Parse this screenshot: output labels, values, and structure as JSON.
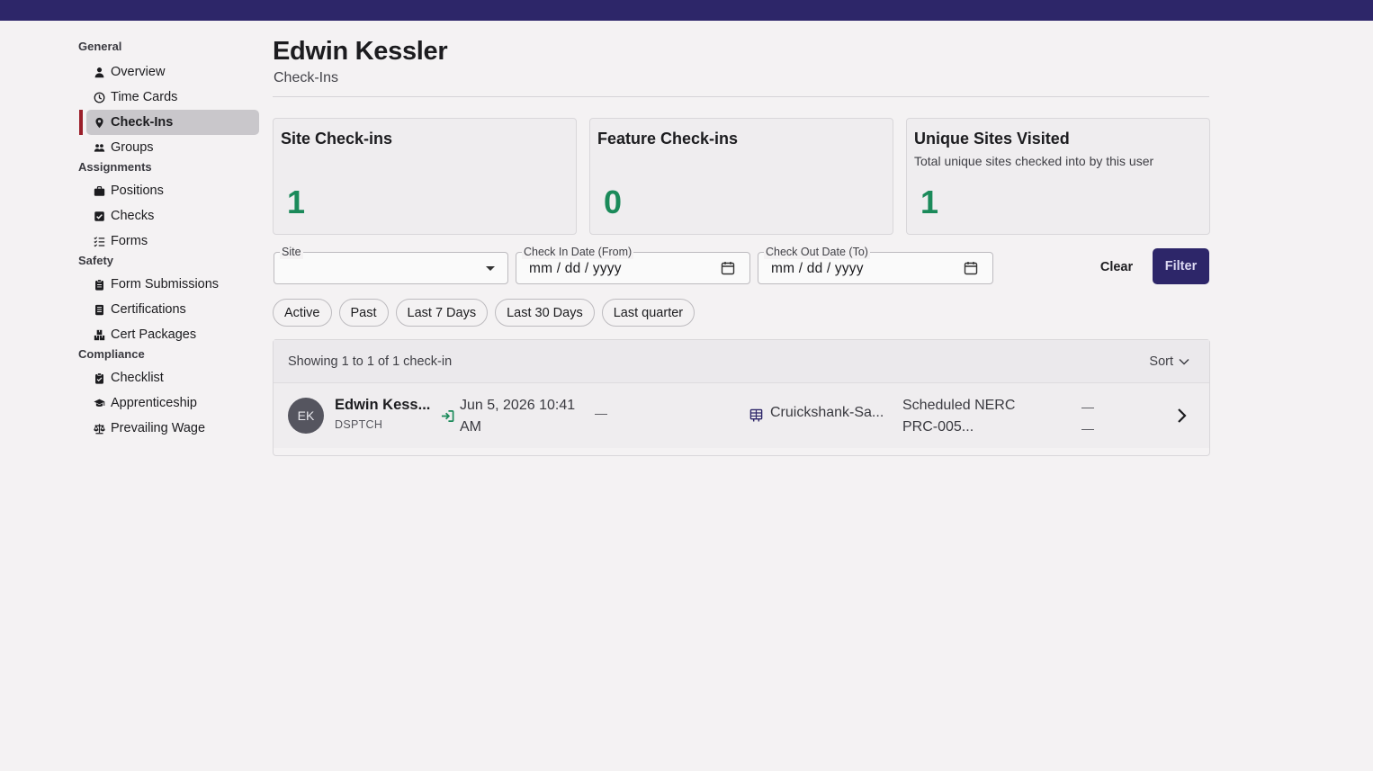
{
  "colors": {
    "topbar": "#2d2669",
    "accent": "#2d2669",
    "active_marker": "#9b1f2a",
    "value_green": "#1b8a5a"
  },
  "sidebar": {
    "sections": [
      {
        "title": "General",
        "items": [
          {
            "label": "Overview",
            "icon": "user-icon"
          },
          {
            "label": "Time Cards",
            "icon": "clock-icon"
          },
          {
            "label": "Check-Ins",
            "icon": "map-pin-icon",
            "active": true
          },
          {
            "label": "Groups",
            "icon": "users-icon"
          }
        ]
      },
      {
        "title": "Assignments",
        "items": [
          {
            "label": "Positions",
            "icon": "briefcase-icon"
          },
          {
            "label": "Checks",
            "icon": "check-square-icon"
          },
          {
            "label": "Forms",
            "icon": "list-check-icon"
          }
        ]
      },
      {
        "title": "Safety",
        "items": [
          {
            "label": "Form Submissions",
            "icon": "clipboard-icon"
          },
          {
            "label": "Certifications",
            "icon": "document-icon"
          },
          {
            "label": "Cert Packages",
            "icon": "boxes-icon"
          }
        ]
      },
      {
        "title": "Compliance",
        "items": [
          {
            "label": "Checklist",
            "icon": "clipboard-check-icon"
          },
          {
            "label": "Apprenticeship",
            "icon": "graduation-cap-icon"
          },
          {
            "label": "Prevailing Wage",
            "icon": "scale-icon"
          }
        ]
      }
    ]
  },
  "header": {
    "title": "Edwin Kessler",
    "subtitle": "Check-Ins"
  },
  "cards": [
    {
      "title": "Site Check-ins",
      "description": "",
      "value": "1"
    },
    {
      "title": "Feature Check-ins",
      "description": "",
      "value": "0"
    },
    {
      "title": "Unique Sites Visited",
      "description": "Total unique sites checked into by this user",
      "value": "1"
    }
  ],
  "filters": {
    "site_label": "Site",
    "site_value": "",
    "checkin_label": "Check In Date (From)",
    "checkin_placeholder": "mm / dd / yyyy",
    "checkout_label": "Check Out Date (To)",
    "checkout_placeholder": "mm / dd / yyyy",
    "clear_label": "Clear",
    "filter_label": "Filter"
  },
  "chips": [
    "Active",
    "Past",
    "Last 7 Days",
    "Last 30 Days",
    "Last quarter"
  ],
  "results": {
    "showing": "Showing 1 to 1 of 1 check-in",
    "sort_label": "Sort",
    "rows": [
      {
        "initials": "EK",
        "name": "Edwin Kess...",
        "role": "DSPTCH",
        "checkin": "Jun 5, 2026 10:41 AM",
        "checkout": "—",
        "site": "Cruickshank-Sa...",
        "cert": "Scheduled NERC PRC-005...",
        "extra1": "—",
        "extra2": "—"
      }
    ]
  }
}
